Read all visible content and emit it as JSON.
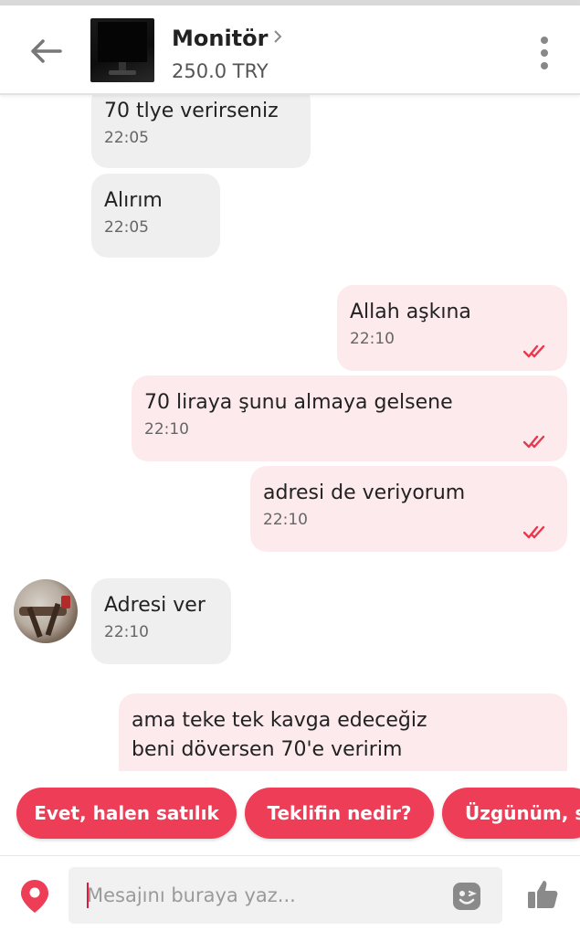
{
  "header": {
    "title": "Monitör",
    "price": "250.0 TRY"
  },
  "messages": [
    {
      "direction": "in",
      "text": "70 tlye verirseniz",
      "time": "22:05"
    },
    {
      "direction": "in",
      "text": "Alırım",
      "time": "22:05"
    },
    {
      "direction": "out",
      "text": "Allah aşkına",
      "time": "22:10",
      "status": "read"
    },
    {
      "direction": "out",
      "text": "70 liraya şunu almaya gelsene",
      "time": "22:10",
      "status": "read"
    },
    {
      "direction": "out",
      "text": "adresi de veriyorum",
      "time": "22:10",
      "status": "read"
    },
    {
      "direction": "in",
      "text": "Adresi ver",
      "time": "22:10"
    },
    {
      "direction": "out",
      "text": "ama teke tek kavga edeceğiz\nbeni döversen 70'e veririm",
      "time": "",
      "status": "read"
    }
  ],
  "quick_replies": [
    "Evet, halen satılık",
    "Teklifin nedir?",
    "Üzgünüm, s"
  ],
  "composer": {
    "placeholder": "Mesajını buraya yaz..."
  },
  "icons": {
    "back": "arrow-left-icon",
    "title_chevron": "chevron-right-icon",
    "more": "more-vertical-icon",
    "read_status": "double-check-icon",
    "location": "location-pin-icon",
    "emoji": "emoji-icon",
    "like": "thumbs-up-icon"
  },
  "colors": {
    "accent": "#ee3d56",
    "incoming_bubble": "#efefef",
    "outgoing_bubble": "#fdeaed",
    "read_tick": "#e8384f"
  }
}
